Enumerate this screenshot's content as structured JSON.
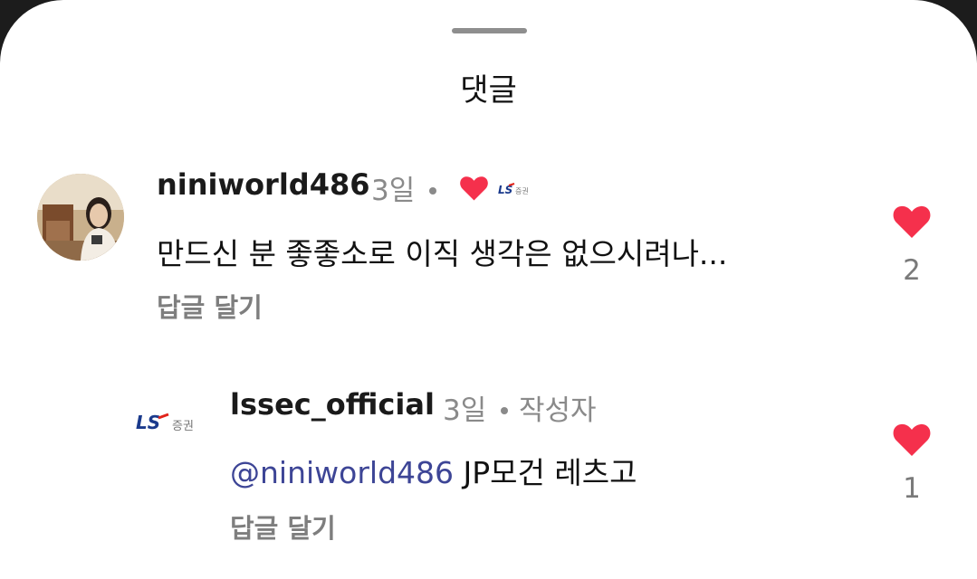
{
  "sheet": {
    "title": "댓글"
  },
  "comments": [
    {
      "username": "niniworld486",
      "time": "3일",
      "text": "만드신 분 좋좋소로 이직 생각은 없으시려나...",
      "reply_label": "답글 달기",
      "like_count": "2",
      "liked_by_author_logo": "LS증권"
    },
    {
      "username": "lssec_official",
      "time": "3일",
      "author_badge": "작성자",
      "mention": "@niniworld486",
      "text": " JP모건 레츠고",
      "reply_label": "답글 달기",
      "like_count": "1",
      "avatar_logo": "LS증권"
    }
  ],
  "colors": {
    "heart": "#f5304c",
    "mention": "#3d4596",
    "meta": "#8a8a8a"
  },
  "icons": [
    "drag-handle",
    "heart-icon",
    "ls-securities-logo"
  ]
}
